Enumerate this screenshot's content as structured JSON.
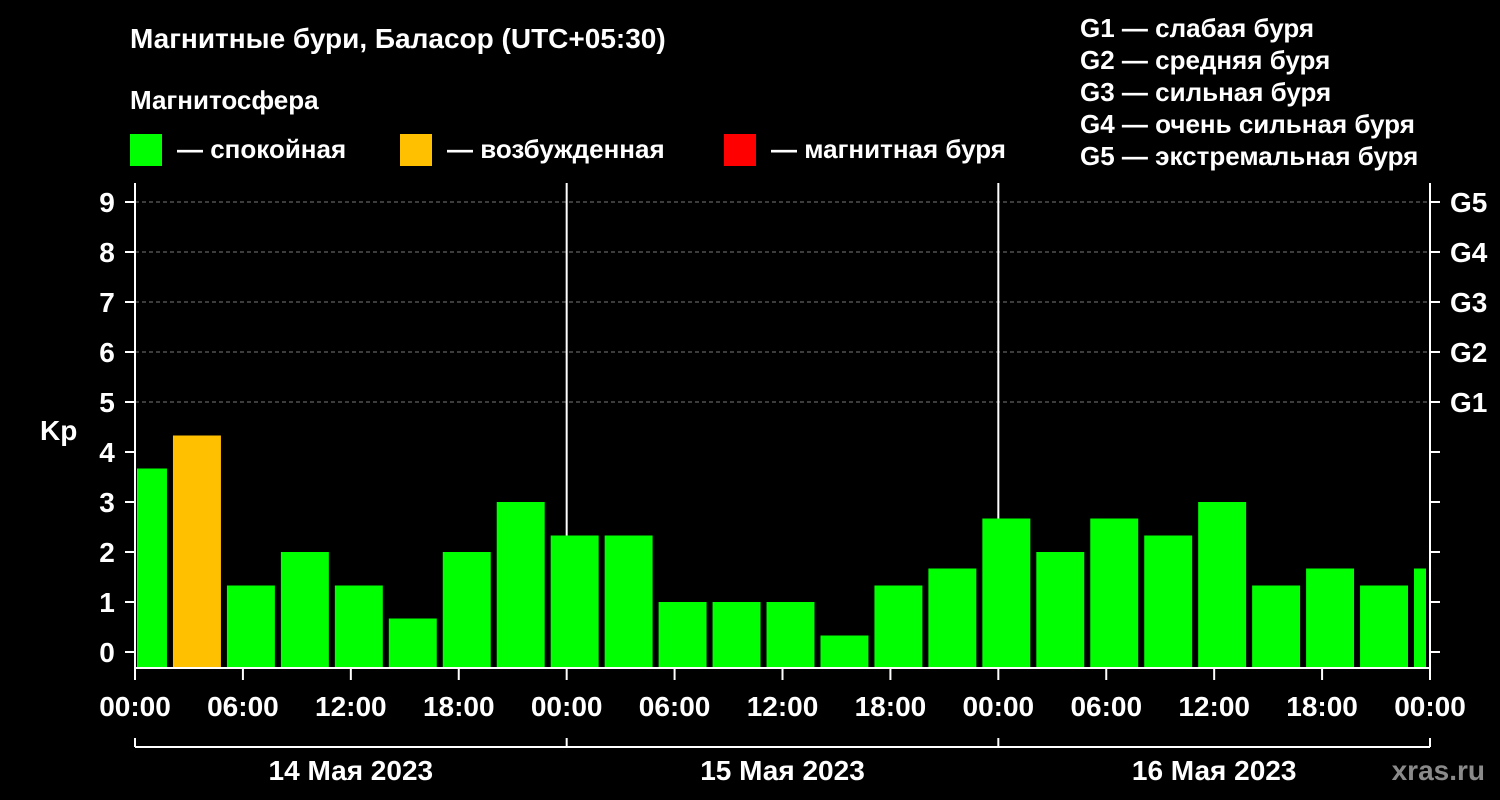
{
  "chart_data": {
    "type": "bar",
    "title": "Магнитные бури, Баласор (UTC+05:30)",
    "ylabel": "Kp",
    "ylim": [
      0,
      9
    ],
    "yticks": [
      0,
      1,
      2,
      3,
      4,
      5,
      6,
      7,
      8,
      9
    ],
    "right_ticks": [
      {
        "value": 5,
        "label": "G1"
      },
      {
        "value": 6,
        "label": "G2"
      },
      {
        "value": 7,
        "label": "G3"
      },
      {
        "value": 8,
        "label": "G4"
      },
      {
        "value": 9,
        "label": "G5"
      }
    ],
    "grid": true,
    "legend_title": "Магнитосфера",
    "legend": [
      {
        "label": "— спокойная",
        "color": "#00ff00"
      },
      {
        "label": "— возбужденная",
        "color": "#ffc000"
      },
      {
        "label": "— магнитная буря",
        "color": "#ff0000"
      }
    ],
    "scale_legend": [
      "G1 — слабая буря",
      "G2 — средняя буря",
      "G3 — сильная буря",
      "G4 — очень сильная буря",
      "G5 — экстремальная буря"
    ],
    "xticks": [
      "00:00",
      "06:00",
      "12:00",
      "18:00",
      "00:00",
      "06:00",
      "12:00",
      "18:00",
      "00:00",
      "06:00",
      "12:00",
      "18:00",
      "00:00"
    ],
    "days": [
      "14 Мая 2023",
      "15 Мая 2023",
      "16 Мая 2023"
    ],
    "x_range_hours": [
      0,
      72
    ],
    "bars": [
      {
        "start": 0,
        "end": 2,
        "kp": 3.67,
        "state": "quiet"
      },
      {
        "start": 2,
        "end": 5,
        "kp": 4.33,
        "state": "active"
      },
      {
        "start": 5,
        "end": 8,
        "kp": 1.33,
        "state": "quiet"
      },
      {
        "start": 8,
        "end": 11,
        "kp": 2.0,
        "state": "quiet"
      },
      {
        "start": 11,
        "end": 14,
        "kp": 1.33,
        "state": "quiet"
      },
      {
        "start": 14,
        "end": 17,
        "kp": 0.67,
        "state": "quiet"
      },
      {
        "start": 17,
        "end": 20,
        "kp": 2.0,
        "state": "quiet"
      },
      {
        "start": 20,
        "end": 23,
        "kp": 3.0,
        "state": "quiet"
      },
      {
        "start": 23,
        "end": 26,
        "kp": 2.33,
        "state": "quiet"
      },
      {
        "start": 26,
        "end": 29,
        "kp": 2.33,
        "state": "quiet"
      },
      {
        "start": 29,
        "end": 32,
        "kp": 1.0,
        "state": "quiet"
      },
      {
        "start": 32,
        "end": 35,
        "kp": 1.0,
        "state": "quiet"
      },
      {
        "start": 35,
        "end": 38,
        "kp": 1.0,
        "state": "quiet"
      },
      {
        "start": 38,
        "end": 41,
        "kp": 0.33,
        "state": "quiet"
      },
      {
        "start": 41,
        "end": 44,
        "kp": 1.33,
        "state": "quiet"
      },
      {
        "start": 44,
        "end": 47,
        "kp": 1.67,
        "state": "quiet"
      },
      {
        "start": 47,
        "end": 50,
        "kp": 2.67,
        "state": "quiet"
      },
      {
        "start": 50,
        "end": 53,
        "kp": 2.0,
        "state": "quiet"
      },
      {
        "start": 53,
        "end": 56,
        "kp": 2.67,
        "state": "quiet"
      },
      {
        "start": 56,
        "end": 59,
        "kp": 2.33,
        "state": "quiet"
      },
      {
        "start": 59,
        "end": 62,
        "kp": 3.0,
        "state": "quiet"
      },
      {
        "start": 62,
        "end": 65,
        "kp": 1.33,
        "state": "quiet"
      },
      {
        "start": 65,
        "end": 68,
        "kp": 1.67,
        "state": "quiet"
      },
      {
        "start": 68,
        "end": 71,
        "kp": 1.33,
        "state": "quiet"
      },
      {
        "start": 71,
        "end": 72,
        "kp": 1.67,
        "state": "quiet"
      }
    ],
    "colors": {
      "quiet": "#00ff00",
      "active": "#ffc000",
      "storm": "#ff0000"
    },
    "watermark": "xras.ru"
  }
}
